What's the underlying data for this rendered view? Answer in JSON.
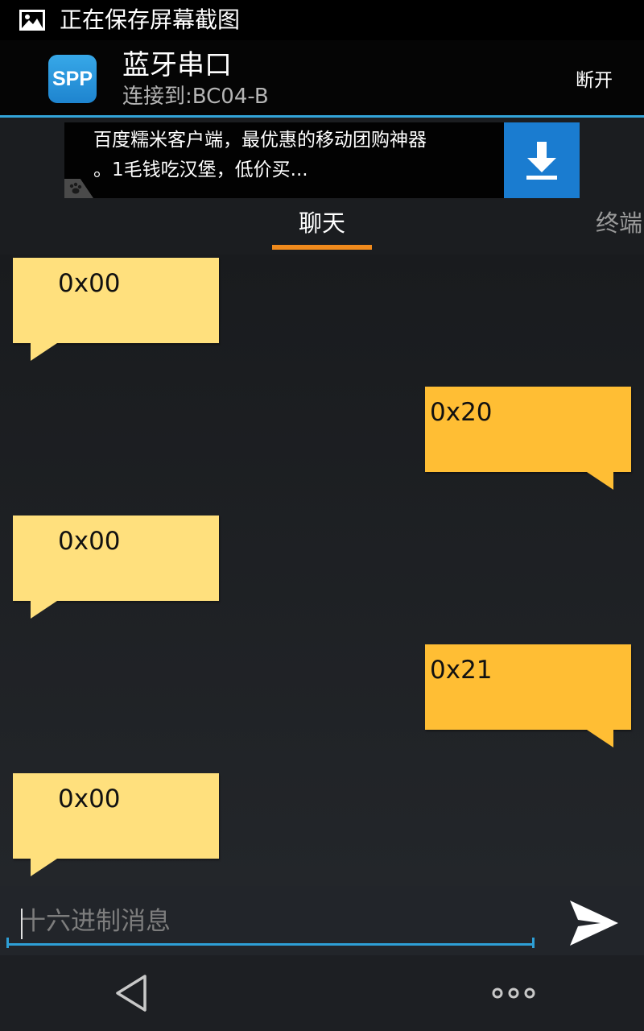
{
  "status_bar": {
    "text": "正在保存屏幕截图",
    "icon": "image-icon"
  },
  "action_bar": {
    "app_icon_text": "SPP",
    "title": "蓝牙串口",
    "subtitle": "连接到:BC04-B",
    "disconnect_label": "断开"
  },
  "ad": {
    "line1": "百度糯米客户端，最优惠的移动团购神器",
    "line2": "。1毛钱吃汉堡，低价买...",
    "icon": "download-icon"
  },
  "tabs": {
    "chat": "聊天",
    "terminal": "终端"
  },
  "messages": [
    {
      "direction": "in",
      "text": "0x00"
    },
    {
      "direction": "out",
      "text": "0x20"
    },
    {
      "direction": "in",
      "text": "0x00"
    },
    {
      "direction": "out",
      "text": "0x21"
    },
    {
      "direction": "in",
      "text": "0x00"
    }
  ],
  "input": {
    "placeholder": "十六进制消息",
    "value": ""
  },
  "colors": {
    "accent": "#33a4d8",
    "tab_indicator": "#f08a1c",
    "incoming_bubble": "#ffe07d",
    "outgoing_bubble": "#ffbe34"
  }
}
